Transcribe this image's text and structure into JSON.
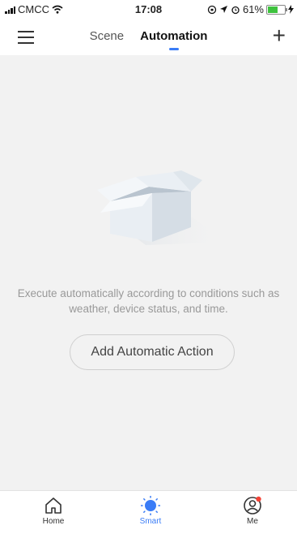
{
  "status_bar": {
    "carrier": "CMCC",
    "time": "17:08",
    "battery": "61%",
    "battery_level": 0.61
  },
  "header": {
    "tabs": [
      {
        "label": "Scene",
        "active": false
      },
      {
        "label": "Automation",
        "active": true
      }
    ],
    "menu_icon": "hamburger-icon",
    "add_icon": "plus-icon",
    "accent_color": "#3a7cf6"
  },
  "empty_state": {
    "illustration": "open-box-icon",
    "line1": "Execute automatically according to conditions such as",
    "line2": "weather, device status, and time.",
    "button_label": "Add Automatic Action"
  },
  "tab_bar": {
    "items": [
      {
        "label": "Home",
        "icon": "home-icon",
        "active": false
      },
      {
        "label": "Smart",
        "icon": "sun-icon",
        "active": true
      },
      {
        "label": "Me",
        "icon": "user-icon",
        "active": false,
        "badge": true
      }
    ],
    "badge_color": "#f44336"
  }
}
